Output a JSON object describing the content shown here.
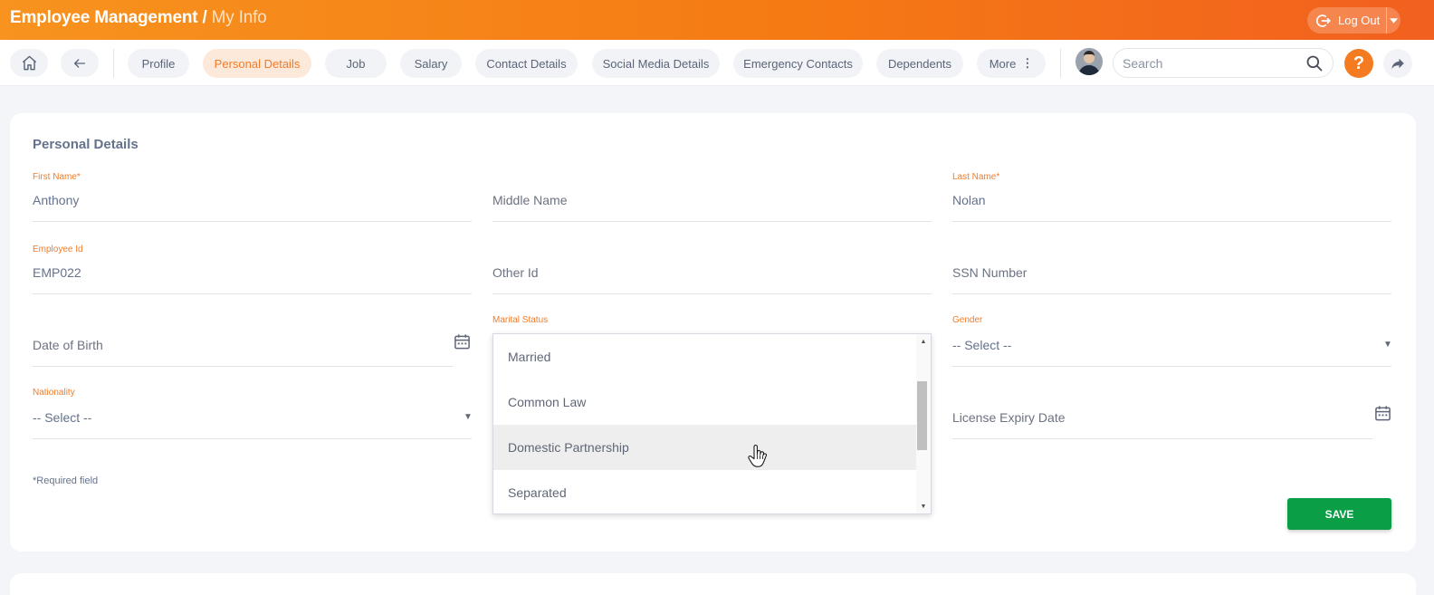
{
  "header": {
    "title": "Employee Management",
    "separator": "/",
    "subtitle": "My Info",
    "logout_label": "Log Out",
    "logout_icon": "logout-icon",
    "colors": {
      "accent": "#f47b20",
      "save": "#0a9e47"
    }
  },
  "nav": {
    "home_icon": "home-icon",
    "back_icon": "arrow-left-icon",
    "tabs": [
      {
        "label": "Profile",
        "active": false
      },
      {
        "label": "Personal Details",
        "active": true
      },
      {
        "label": "Job",
        "active": false
      },
      {
        "label": "Salary",
        "active": false
      },
      {
        "label": "Contact Details",
        "active": false
      },
      {
        "label": "Social Media Details",
        "active": false
      },
      {
        "label": "Emergency Contacts",
        "active": false
      },
      {
        "label": "Dependents",
        "active": false
      },
      {
        "label": "More",
        "active": false
      }
    ],
    "search_placeholder": "Search",
    "help_label": "?"
  },
  "form": {
    "title": "Personal Details",
    "first_name": {
      "label": "First Name*",
      "value": "Anthony"
    },
    "middle_name": {
      "placeholder": "Middle Name"
    },
    "last_name": {
      "label": "Last Name*",
      "value": "Nolan"
    },
    "employee_id": {
      "label": "Employee Id",
      "value": "EMP022"
    },
    "other_id": {
      "placeholder": "Other Id"
    },
    "ssn": {
      "placeholder": "SSN Number"
    },
    "dob": {
      "placeholder": "Date of Birth"
    },
    "marital_status": {
      "label": "Marital Status",
      "options": [
        "Married",
        "Common Law",
        "Domestic Partnership",
        "Separated"
      ],
      "hovered": "Domestic Partnership"
    },
    "gender": {
      "label": "Gender",
      "value": "-- Select --"
    },
    "nationality": {
      "label": "Nationality",
      "value": "-- Select --"
    },
    "license_expiry": {
      "placeholder": "License Expiry Date"
    },
    "required_note": "*Required field",
    "save_label": "SAVE"
  }
}
